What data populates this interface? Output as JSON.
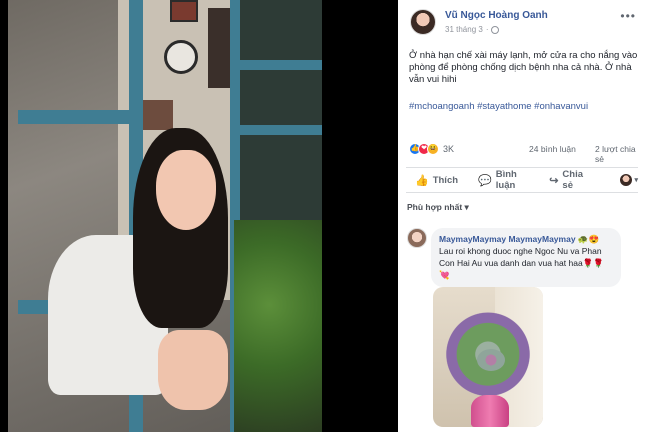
{
  "post": {
    "author": "Vũ Ngọc Hoàng Oanh",
    "timestamp": "31 tháng 3",
    "more_label": "•••",
    "text": "Ở nhà hạn chế xài máy lạnh, mở cửa ra cho nắng vào phòng để phòng chống dịch bệnh nha cả nhà. Ở nhà vẫn vui hihi",
    "hashtags": "#mchoangoanh #stayathome #onhavanvui"
  },
  "stats": {
    "reaction_count": "3K",
    "comments": "24 bình luận",
    "shares": "2 lượt chia sẻ"
  },
  "actions": {
    "like": "Thích",
    "comment": "Bình luận",
    "share": "Chia sẻ"
  },
  "sort": {
    "label": "Phù hợp nhất ▾"
  },
  "comment": {
    "author": "MaymayMaymay MaymayMaymay",
    "author_emoji": " 🐢😍",
    "text": "Lau roi khong duoc nghe Ngoc Nu va Phan Con Hai Au vua danh dan vua hat haa🌹🌹💘"
  },
  "icons": {
    "like_reaction": "👍",
    "love_reaction": "❤",
    "haha_reaction": "😆",
    "like_action": "👍",
    "comment_action": "💬",
    "share_action": "↪",
    "globe": "globe-icon",
    "more": "more-icon"
  },
  "colors": {
    "link_blue": "#385898",
    "text": "#1d2129",
    "muted": "#606770",
    "like_blue": "#1877f2",
    "love_red": "#f02849",
    "haha_yellow": "#f7b125"
  }
}
